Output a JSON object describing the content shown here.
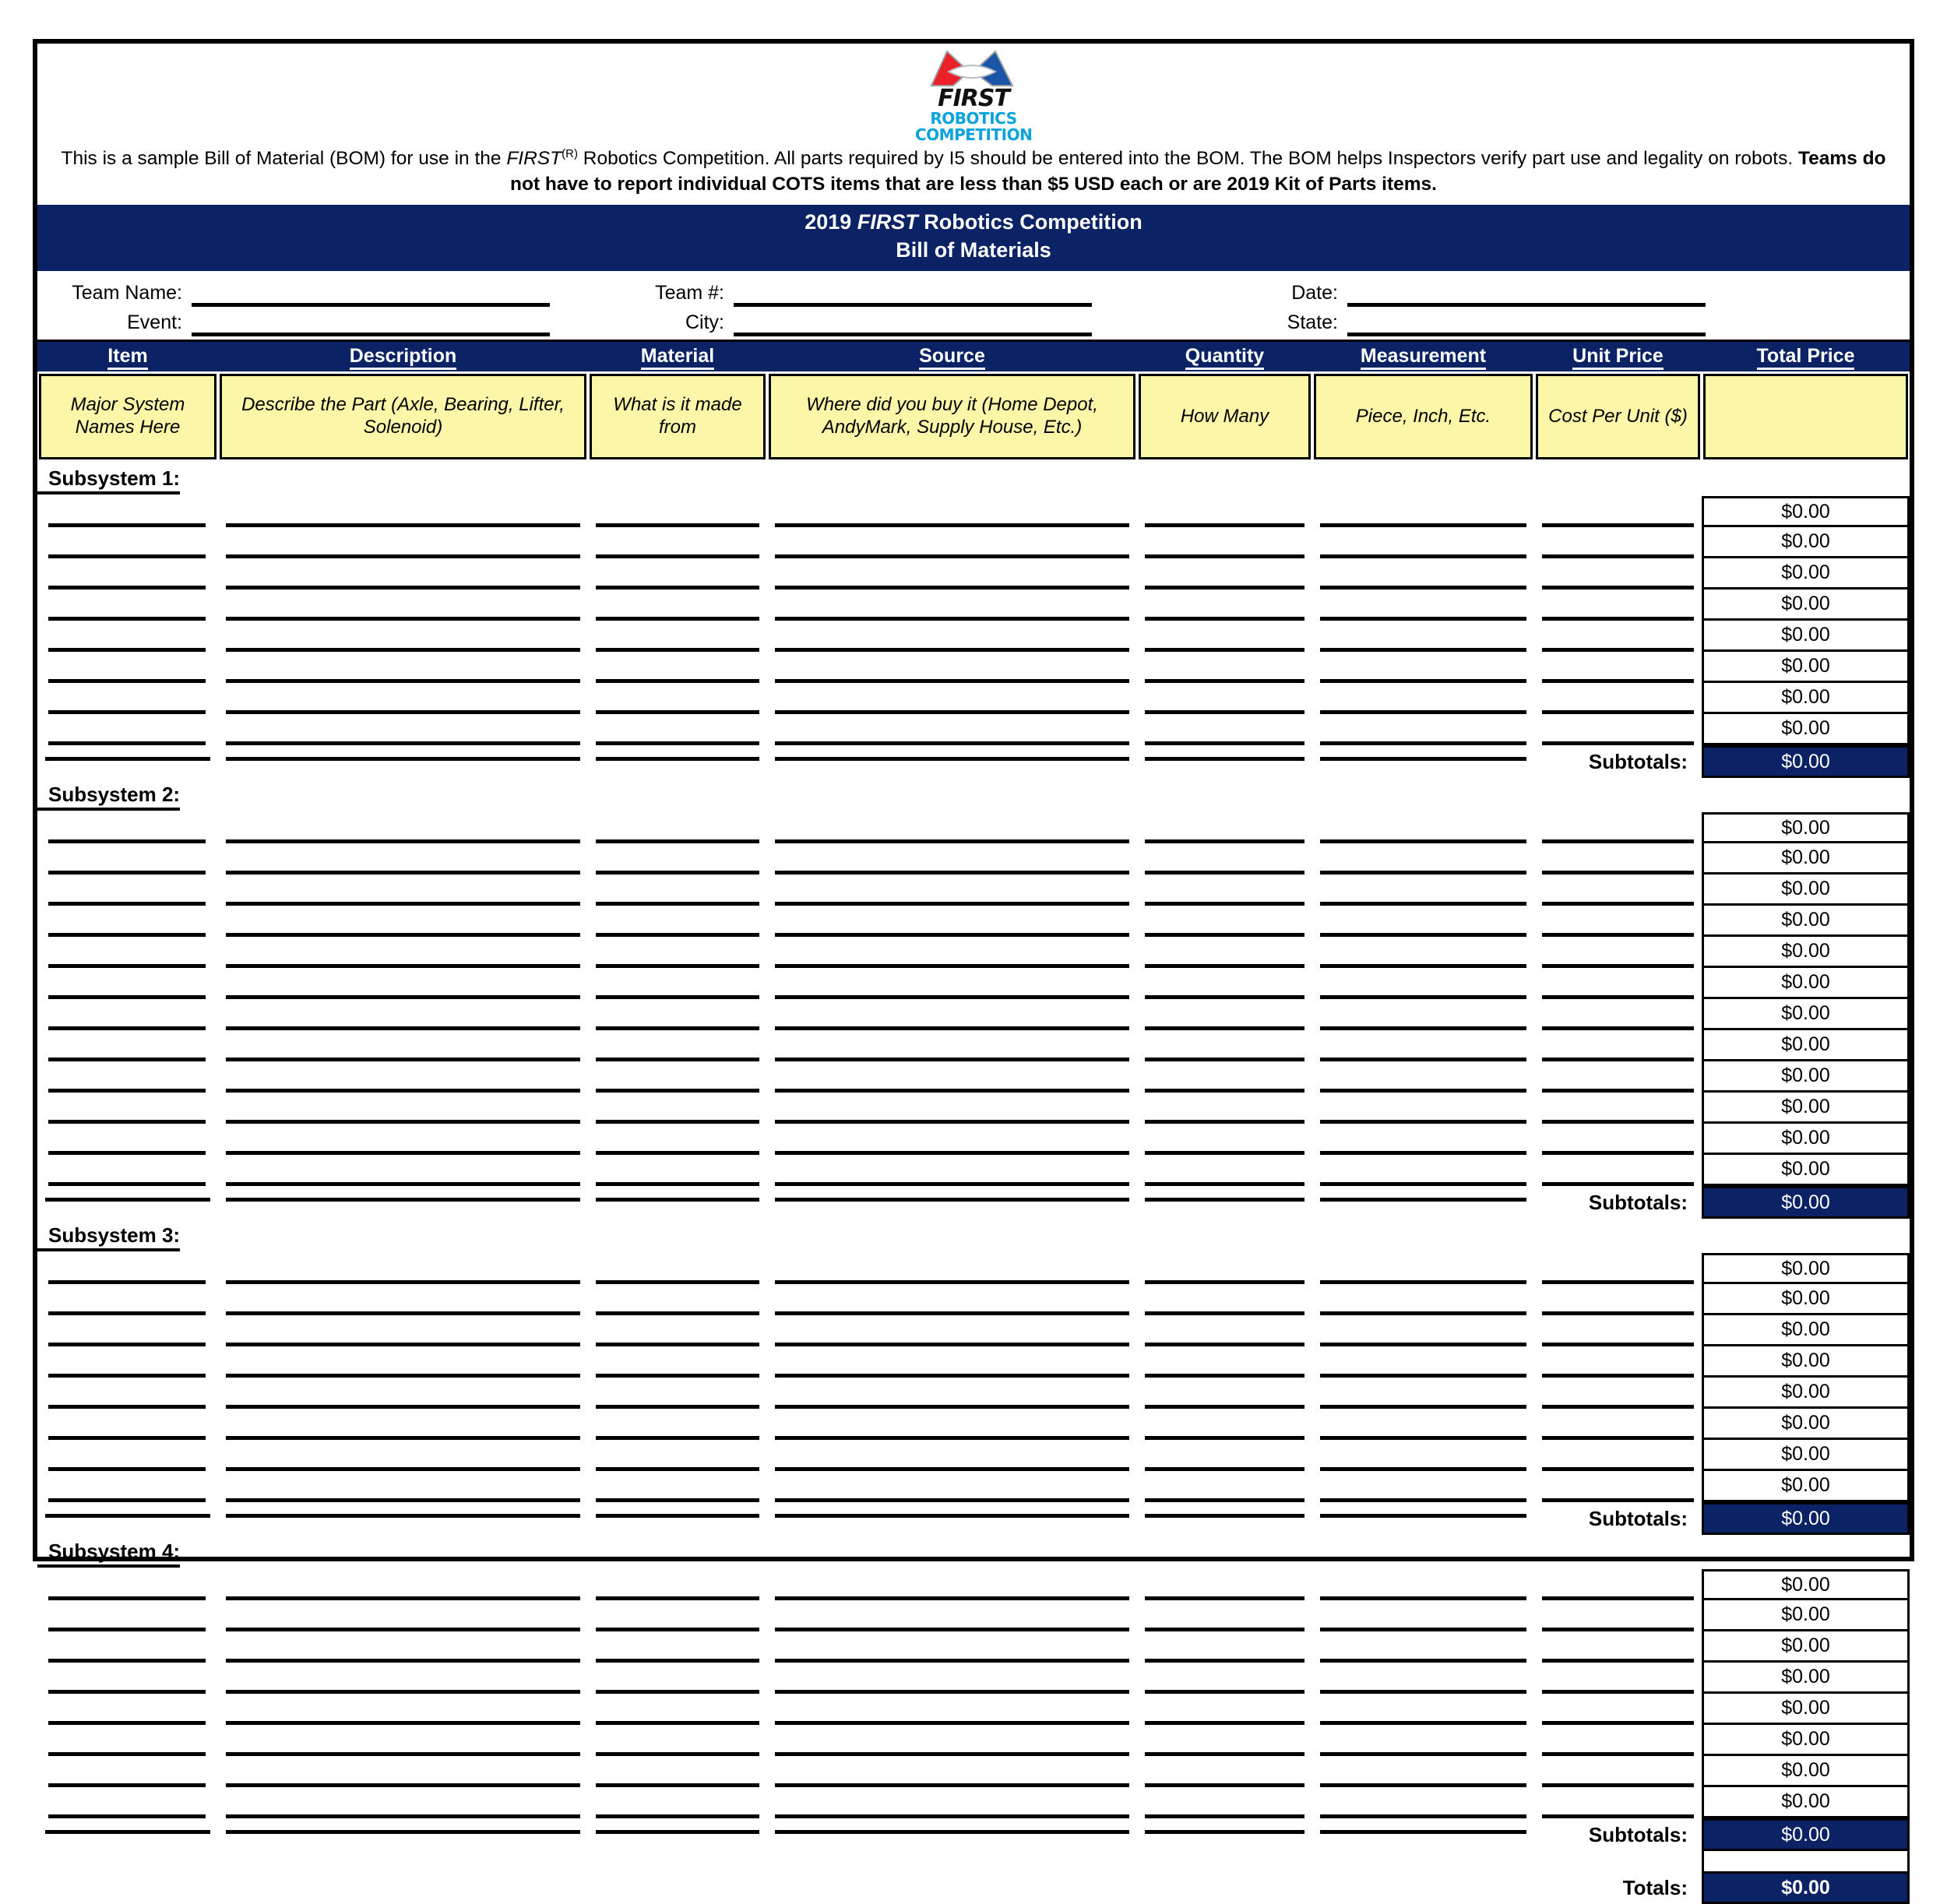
{
  "logo": {
    "wordmark": "FIRST",
    "line2": "ROBOTICS",
    "line3": "COMPETITION",
    "accent_color": "#0aa3dd"
  },
  "intro": {
    "part1": "This is a sample Bill of Material (BOM) for use in the ",
    "brand": "FIRST",
    "sup": "(R)",
    "part2": " Robotics Competition. All parts required by I5 should be entered into the BOM. The BOM helps Inspectors verify part use and legality on robots. ",
    "bold": "Teams do not have to report individual COTS items that are less than $5 USD each or are 2019 Kit of Parts items."
  },
  "title": {
    "line1_pre": "2019 ",
    "line1_brand": "FIRST",
    "line1_post": " Robotics Competition",
    "line2": "Bill of Materials",
    "background": "#0b2265"
  },
  "info": {
    "team_name_label": "Team Name:",
    "event_label": "Event:",
    "team_number_label": "Team #:",
    "city_label": "City:",
    "date_label": "Date:",
    "state_label": "State:",
    "team_name_value": "",
    "event_value": "",
    "team_number_value": "",
    "city_value": "",
    "date_value": "",
    "state_value": ""
  },
  "table": {
    "headers": [
      "Item",
      "Description",
      "Material",
      "Source",
      "Quantity",
      "Measurement",
      "Unit Price",
      "Total Price"
    ],
    "subheaders": [
      "Major System Names Here",
      "Describe the Part (Axle, Bearing, Lifter, Solenoid)",
      "What is it made from",
      "Where did you buy it (Home Depot, AndyMark, Supply House, Etc.)",
      "How Many",
      "Piece, Inch, Etc.",
      "Cost Per Unit ($)",
      ""
    ],
    "header_bg": "#0b2265",
    "subheader_bg": "#fbf6a8",
    "zero_value": "$0.00",
    "subtotals_label": "Subtotals:",
    "totals_label": "Totals:",
    "sections": [
      {
        "label": "Subsystem 1:",
        "rows": 8,
        "subtotal": "$0.00"
      },
      {
        "label": "Subsystem 2:",
        "rows": 12,
        "subtotal": "$0.00"
      },
      {
        "label": "Subsystem 3:",
        "rows": 8,
        "subtotal": "$0.00"
      },
      {
        "label": "Subsystem 4:",
        "rows": 8,
        "subtotal": "$0.00"
      }
    ],
    "grand_total": "$0.00"
  }
}
